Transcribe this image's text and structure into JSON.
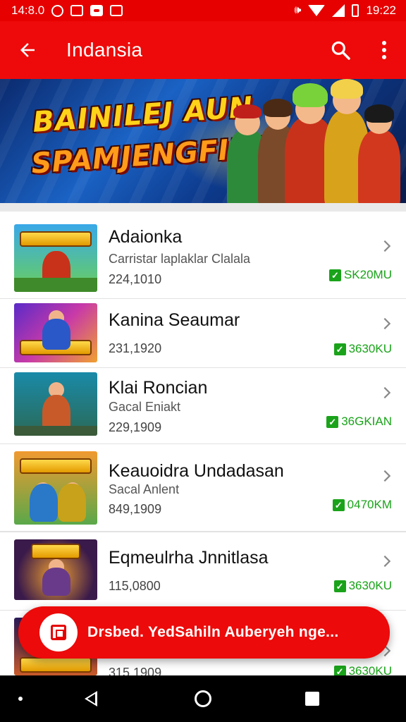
{
  "status_bar": {
    "time_left": "14:8.0",
    "time_right": "19:22",
    "colors": {
      "background": "#e60000"
    },
    "icons": [
      "notification-icon",
      "app-icon",
      "message-icon",
      "vibrate-icon",
      "wifi-icon",
      "signal-icon",
      "battery-icon"
    ]
  },
  "app_bar": {
    "title": "Indansia",
    "background": "#ee0a0a",
    "icons": [
      "back-arrow-icon",
      "search-icon",
      "more-vert-icon"
    ]
  },
  "banner": {
    "line1": "BAINILEJ AUN",
    "line2": "SPAMJENGFIN!"
  },
  "games": [
    {
      "name": "Adaionka",
      "subtitle": "Carristar laplaklar Clalala",
      "count": "224,1010",
      "downloads": "SK20MU",
      "theme": "jungle"
    },
    {
      "name": "Kanina Seaumar",
      "subtitle": "",
      "count": "231,1920",
      "downloads": "3630KU",
      "theme": "purple"
    },
    {
      "name": "Klai Roncian",
      "subtitle": "Gacal Eniakt",
      "count": "229,1909",
      "downloads": "36GKIAN",
      "theme": "teal"
    },
    {
      "name": "Keauoidra Undadasan",
      "subtitle": "Sacal Anlent",
      "count": "849,1909",
      "downloads": "0470KM",
      "theme": "sunset"
    },
    {
      "name": "Eqmeulrha Jnnitlasa",
      "subtitle": "",
      "count": "115,0800",
      "downloads": "3630KU",
      "theme": "dark"
    },
    {
      "name": "",
      "subtitle": "",
      "count": "315,1909",
      "downloads": "3630KU",
      "theme": "fantasy"
    }
  ],
  "snackbar": {
    "text": "Drsbed. YedSahiln Auberyeh nge...",
    "background": "#ec0a0a"
  },
  "nav_bar": {
    "icons": [
      "nav-dot-icon",
      "nav-back-icon",
      "nav-home-icon",
      "nav-recents-icon"
    ]
  }
}
